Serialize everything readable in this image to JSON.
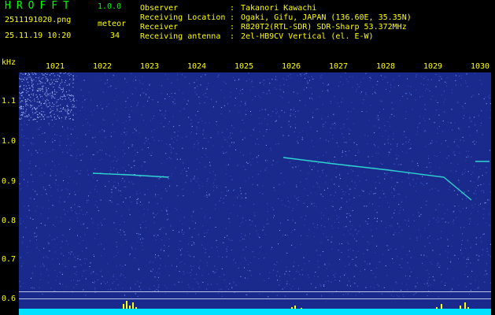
{
  "app": {
    "title": "HROFFT",
    "version": "1.0.0"
  },
  "file": {
    "name": "2511191020.png",
    "datetime": "25.11.19 10:20"
  },
  "meteor": {
    "label": "meteor",
    "count": "34"
  },
  "info": {
    "observer_label": "Observer",
    "observer_value": "Takanori Kawachi",
    "location_label": "Receiving Location",
    "location_value": "Ogaki, Gifu, JAPAN (136.60E, 35.35N)",
    "receiver_label": "Receiver",
    "receiver_value": "R820T2(RTL-SDR) SDR-Sharp 53.372MHz",
    "antenna_label": "Receiving antenna",
    "antenna_value": "2el-HB9CV Vertical (el. E-W)",
    "separator": ":"
  },
  "axes": {
    "y_unit": "kHz",
    "y_ticks": [
      "1.1",
      "1.0",
      "0.9",
      "0.8",
      "0.7",
      "0.6"
    ],
    "x_ticks": [
      "1021",
      "1022",
      "1023",
      "1024",
      "1025",
      "1026",
      "1027",
      "1028",
      "1029",
      "1030"
    ]
  },
  "colors": {
    "text": "#ffff00",
    "title": "#00ff00",
    "background": "#1a2a8c",
    "echo": "#2fd3d0",
    "baseline": "#00e0ff"
  }
}
